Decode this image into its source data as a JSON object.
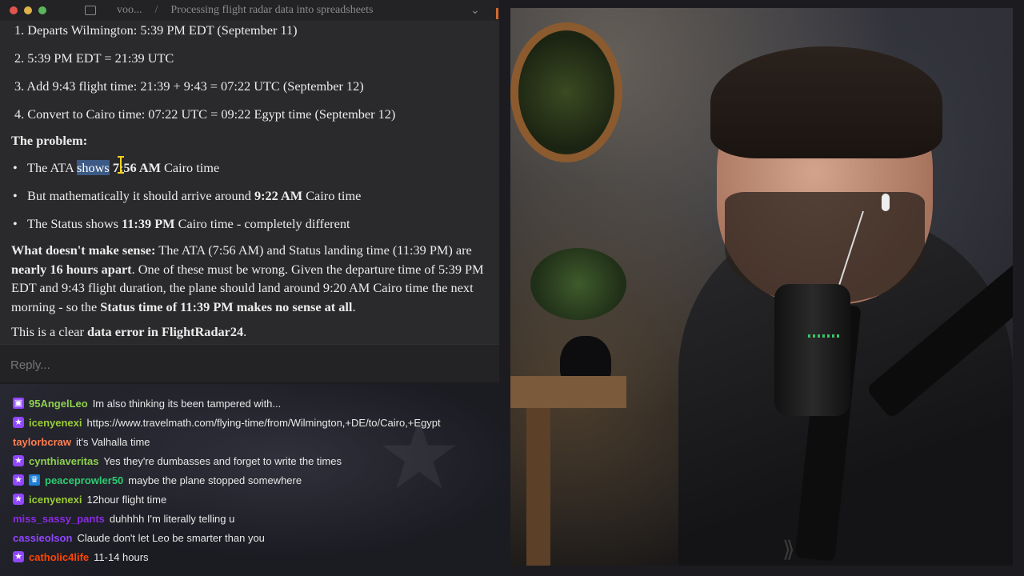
{
  "claude_window": {
    "breadcrumb_org": "voo...",
    "breadcrumb_sep": "/",
    "conversation_title": "Processing flight radar data into spreadsheets",
    "steps": [
      "1. Departs Wilmington: 5:39 PM EDT (September 11)",
      "2. 5:39 PM EDT = 21:39 UTC",
      "3. Add 9:43 flight time: 21:39 + 9:43 = 07:22 UTC (September 12)",
      "4. Convert to Cairo time: 07:22 UTC = 09:22 Egypt time (September 12)"
    ],
    "problem_heading": "The problem:",
    "bullets": {
      "b1_pre": "The ATA ",
      "b1_highlight": "shows",
      "b1_mid": " ",
      "b1_bold": "7:56 AM",
      "b1_post": " Cairo time",
      "b2_pre": "But mathematically it should arrive around ",
      "b2_bold": "9:22 AM",
      "b2_post": " Cairo time",
      "b3_pre": "The Status shows ",
      "b3_bold": "11:39 PM",
      "b3_post": " Cairo time - completely different"
    },
    "paragraph": {
      "lead_bold": "What doesn't make sense:",
      "text1": " The ATA (7:56 AM) and Status landing time (11:39 PM) are ",
      "bold2": "nearly 16 hours apart",
      "text2": ". One of these must be wrong. Given the departure time of 5:39 PM EDT and 9:43 flight duration, the plane should land around 9:20 AM Cairo time the next morning - so the ",
      "bold3": "Status time of 11:39 PM makes no sense at all",
      "text3": "."
    },
    "conclusion": {
      "pre": "This is a clear ",
      "bold": "data error in FlightRadar24",
      "post": "."
    },
    "reply_placeholder": "Reply..."
  },
  "twitch_chat": [
    {
      "user": "95AngelLeo",
      "color": "#8fd14f",
      "badges": [
        "prime"
      ],
      "message": "Im also thinking its been tampered with..."
    },
    {
      "user": "icenyenexi",
      "color": "#9acd32",
      "badges": [
        "star"
      ],
      "message": "https://www.travelmath.com/flying-time/from/Wilmington,+DE/to/Cairo,+Egypt"
    },
    {
      "user": "taylorbcraw",
      "color": "#ff7f50",
      "badges": [],
      "message": "it's Valhalla time"
    },
    {
      "user": "cynthiaveritas",
      "color": "#8fd14f",
      "badges": [
        "star"
      ],
      "message": "Yes they're dumbasses and forget to write the times"
    },
    {
      "user": "peaceprowler50",
      "color": "#2ecc71",
      "badges": [
        "star",
        "crown"
      ],
      "message": "maybe the plane stopped somewhere"
    },
    {
      "user": "icenyenexi",
      "color": "#9acd32",
      "badges": [
        "star"
      ],
      "message": "12hour flight time"
    },
    {
      "user": "miss_sassy_pants",
      "color": "#8a2be2",
      "badges": [],
      "message": "duhhhh I'm literally telling u"
    },
    {
      "user": "cassieolson",
      "color": "#9146ff",
      "badges": [],
      "message": "Claude don't let Leo be smarter than you"
    },
    {
      "user": "catholic4life",
      "color": "#ff4500",
      "badges": [
        "star"
      ],
      "message": "11-14 hours"
    }
  ],
  "colors": {
    "highlight": "#3c5a85",
    "accent": "#d36b2d",
    "twitch_purple": "#9146ff"
  }
}
